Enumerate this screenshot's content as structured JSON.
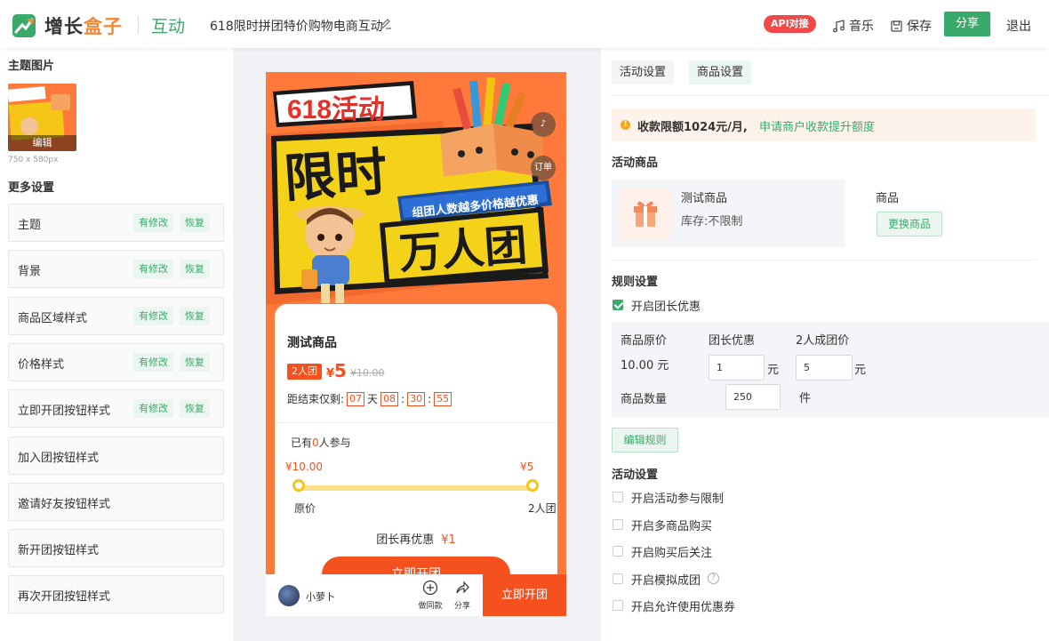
{
  "header": {
    "logo_dark": "增长",
    "logo_orange": "盒子",
    "module": "互动",
    "title": "618限时拼团特价购物电商互动",
    "api_badge": "API对接",
    "music": "音乐",
    "save": "保存",
    "share": "分享",
    "logout": "退出"
  },
  "left": {
    "theme_image_title": "主题图片",
    "thumb_edit": "编辑",
    "thumb_size": "750 x 580px",
    "more_settings_title": "更多设置",
    "modified_label": "有修改",
    "restore_label": "恢复",
    "settings": [
      {
        "label": "主题",
        "modified": true
      },
      {
        "label": "背景",
        "modified": true
      },
      {
        "label": "商品区域样式",
        "modified": true
      },
      {
        "label": "价格样式",
        "modified": true
      },
      {
        "label": "立即开团按钮样式",
        "modified": true
      },
      {
        "label": "加入团按钮样式",
        "modified": false
      },
      {
        "label": "邀请好友按钮样式",
        "modified": false
      },
      {
        "label": "新开团按钮样式",
        "modified": false
      },
      {
        "label": "再次开团按钮样式",
        "modified": false
      }
    ]
  },
  "preview": {
    "banner": {
      "badge": "618活动",
      "headline_1": "限时",
      "headline_2": "万人团",
      "ribbon": "组团人数越多价格越优惠",
      "order_label": "订单"
    },
    "product_name": "测试商品",
    "group_tag": "2人团",
    "price_yen": "¥",
    "price_now": "5",
    "price_old": "¥10.00",
    "countdown_label": "距结束仅剩:",
    "countdown": {
      "days": "07",
      "day_unit": "天",
      "hours": "08",
      "minutes": "30",
      "seconds": "55"
    },
    "participants_prefix": "已有",
    "participants_count": "0",
    "participants_suffix": "人参与",
    "bar_price_left": "¥10.00",
    "bar_price_right": "¥5",
    "bar_label_left": "原价",
    "bar_label_right": "2人团",
    "leader_discount_label": "团长再优惠",
    "leader_discount_value": "¥1",
    "open_group_button": "立即开团",
    "author": "小萝卜",
    "same_style": "做同款",
    "share": "分享",
    "bottom_open": "立即开团"
  },
  "right": {
    "tab_activity": "活动设置",
    "tab_goods": "商品设置",
    "notice_text": "收款限额1024元/月,",
    "notice_link": "申请商户收款提升额度",
    "activity_goods_title": "活动商品",
    "goods_name": "测试商品",
    "goods_stock": "库存:不限制",
    "goods_label": "商品",
    "change_goods": "更换商品",
    "rules_title": "规则设置",
    "leader_discount_enable": "开启团长优惠",
    "col_original": "商品原价",
    "col_leader": "团长优惠",
    "col_group": "2人成团价",
    "original_price": "10.00 元",
    "leader_value": "1",
    "group_value": "5",
    "unit_yuan": "元",
    "qty_label": "商品数量",
    "qty_value": "250",
    "qty_unit": "件",
    "edit_rules": "编辑规则",
    "activity_settings_title": "活动设置",
    "options": [
      {
        "label": "开启活动参与限制",
        "checked": false
      },
      {
        "label": "开启多商品购买",
        "checked": false
      },
      {
        "label": "开启购买后关注",
        "checked": false
      },
      {
        "label": "开启模拟成团",
        "checked": false,
        "help": "?"
      },
      {
        "label": "开启允许使用优惠券",
        "checked": false
      }
    ]
  },
  "colors": {
    "brand_green": "#3aaa6a",
    "brand_orange": "#f08a3a",
    "accent_red": "#f4511e",
    "api_red": "#f24848"
  }
}
